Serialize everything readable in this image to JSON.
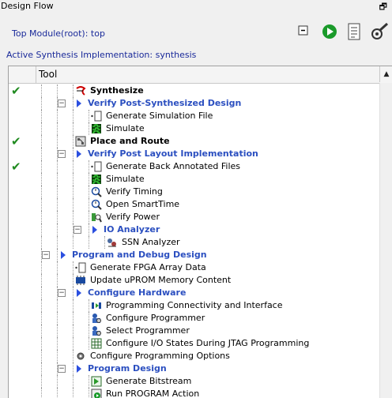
{
  "window": {
    "title": "Design Flow",
    "restore_glyph": "🗗"
  },
  "top_module": "Top Module(root): top",
  "active_impl": "Active Synthesis Implementation: synthesis",
  "toolbar": {
    "icons": [
      "collapse-all-icon",
      "run-icon",
      "report-icon",
      "options-icon"
    ]
  },
  "tree": {
    "header": "Tool",
    "rows": [
      {
        "label": "Synthesize",
        "style": "bold",
        "check": true,
        "icon": "synthesize-icon"
      },
      {
        "label": "Verify Post-Synthesized Design",
        "style": "blue",
        "check": false,
        "icon": "expand-arrow-icon"
      },
      {
        "label": "Generate Simulation File",
        "style": "normal",
        "check": false,
        "icon": "file-icon"
      },
      {
        "label": "Simulate",
        "style": "normal",
        "check": false,
        "icon": "waveform-icon"
      },
      {
        "label": "Place and Route",
        "style": "bold",
        "check": true,
        "icon": "place-route-icon"
      },
      {
        "label": "Verify Post Layout Implementation",
        "style": "blue",
        "check": false,
        "icon": "expand-arrow-icon"
      },
      {
        "label": "Generate Back Annotated Files",
        "style": "normal",
        "check": true,
        "icon": "file-icon"
      },
      {
        "label": "Simulate",
        "style": "normal",
        "check": false,
        "icon": "waveform-icon"
      },
      {
        "label": "Verify Timing",
        "style": "normal",
        "check": false,
        "icon": "timing-icon"
      },
      {
        "label": "Open SmartTime",
        "style": "normal",
        "check": false,
        "icon": "timing-icon"
      },
      {
        "label": "Verify Power",
        "style": "normal",
        "check": false,
        "icon": "power-icon"
      },
      {
        "label": "IO Analyzer",
        "style": "blue",
        "check": false,
        "icon": "expand-arrow-icon"
      },
      {
        "label": "SSN Analyzer",
        "style": "normal",
        "check": false,
        "icon": "ssn-icon"
      },
      {
        "label": "Program and Debug Design",
        "style": "blue",
        "check": false,
        "icon": "expand-arrow-icon"
      },
      {
        "label": "Generate FPGA Array Data",
        "style": "normal",
        "check": false,
        "icon": "file-icon"
      },
      {
        "label": "Update uPROM Memory Content",
        "style": "normal",
        "check": false,
        "icon": "memory-icon"
      },
      {
        "label": "Configure Hardware",
        "style": "blue",
        "check": false,
        "icon": "expand-arrow-icon"
      },
      {
        "label": "Programming Connectivity and Interface",
        "style": "normal",
        "check": false,
        "icon": "connectivity-icon"
      },
      {
        "label": "Configure Programmer",
        "style": "normal",
        "check": false,
        "icon": "programmer-icon"
      },
      {
        "label": "Select Programmer",
        "style": "normal",
        "check": false,
        "icon": "programmer-icon"
      },
      {
        "label": "Configure I/O States During JTAG Programming",
        "style": "normal",
        "check": false,
        "icon": "io-states-icon"
      },
      {
        "label": "Configure Programming Options",
        "style": "normal",
        "check": false,
        "icon": "options-gear-icon"
      },
      {
        "label": "Program Design",
        "style": "blue",
        "check": false,
        "icon": "expand-arrow-icon"
      },
      {
        "label": "Generate Bitstream",
        "style": "normal",
        "check": false,
        "icon": "bitstream-icon"
      },
      {
        "label": "Run PROGRAM Action",
        "style": "normal",
        "check": false,
        "icon": "run-program-icon"
      }
    ]
  },
  "colors": {
    "link_blue": "#2b4fc0",
    "check_green": "#1f8a1f"
  }
}
